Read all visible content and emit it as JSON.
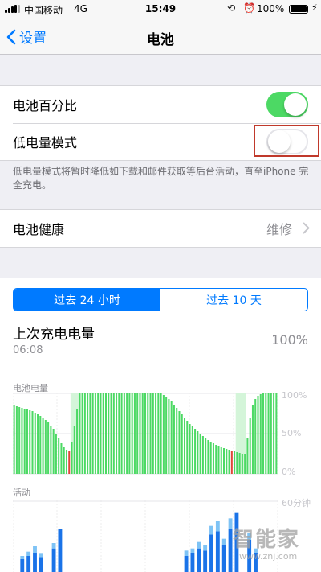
{
  "status_bar": {
    "carrier": "中国移动",
    "network": "4G",
    "time": "15:49",
    "battery_percent": "100%",
    "battery_level": 1.0
  },
  "nav": {
    "back_label": "设置",
    "title": "电池"
  },
  "settings": {
    "battery_percentage": {
      "label": "电池百分比",
      "on": true
    },
    "low_power_mode": {
      "label": "低电量模式",
      "on": false
    },
    "footnote": "低电量模式将暂时降低如下载和邮件获取等后台活动，直至iPhone 完全充电。",
    "battery_health": {
      "label": "电池健康",
      "value": "维修"
    }
  },
  "usage": {
    "tabs": [
      {
        "label": "过去 24 小时",
        "active": true
      },
      {
        "label": "过去 10 天",
        "active": false
      }
    ],
    "last_charge_label": "上次充电电量",
    "last_charge_time": "06:08",
    "last_charge_value": "100%",
    "battery_section_label": "电池电量",
    "battery_ticks": [
      "100%",
      "50%",
      "0%"
    ],
    "activity_section_label": "活动",
    "activity_ticks": [
      "60分钟"
    ]
  },
  "colors": {
    "accent": "#007aff",
    "switch_on": "#4cd964",
    "bar_green": "#4cd964",
    "bar_red": "#e0453a",
    "activity_dark": "#1a73e8",
    "activity_light": "#7ec3f5",
    "highlight_box": "#c0392b"
  },
  "chart_data": [
    {
      "type": "bar",
      "title": "电池电量",
      "ylim": [
        0,
        100
      ],
      "y_ticks": [
        "100%",
        "50%",
        "0%"
      ],
      "values": [
        85,
        84,
        83,
        82,
        81,
        80,
        79,
        78,
        76,
        74,
        72,
        70,
        67,
        64,
        60,
        56,
        50,
        44,
        38,
        33,
        30,
        28,
        40,
        60,
        80,
        100,
        100,
        100,
        100,
        100,
        100,
        100,
        100,
        100,
        100,
        100,
        100,
        100,
        100,
        100,
        100,
        100,
        100,
        100,
        100,
        100,
        100,
        100,
        100,
        100,
        100,
        100,
        100,
        100,
        100,
        100,
        100,
        98,
        96,
        93,
        90,
        86,
        82,
        78,
        74,
        70,
        66,
        62,
        59,
        56,
        53,
        50,
        47,
        44,
        42,
        40,
        38,
        36,
        34,
        33,
        32,
        31,
        30,
        29,
        28,
        27,
        26,
        25,
        25,
        45,
        70,
        85,
        93,
        97,
        99,
        100,
        100,
        100,
        100,
        100,
        100
      ],
      "charging_ranges": [
        [
          22,
          25
        ],
        [
          85,
          88
        ]
      ],
      "low_bars": [
        21,
        83
      ]
    },
    {
      "type": "bar",
      "title": "活动",
      "y_ticks": [
        "60分钟"
      ],
      "series": [
        {
          "values": [
            0,
            12,
            15,
            18,
            14,
            0,
            22,
            40,
            0,
            0,
            0,
            0,
            0,
            0,
            0,
            0,
            0,
            0,
            0,
            0,
            0,
            0,
            0,
            0,
            0,
            0,
            0,
            15,
            18,
            22,
            20,
            35,
            38,
            25,
            40,
            55,
            0,
            30,
            18,
            0,
            0,
            0
          ]
        },
        {
          "values": [
            0,
            3,
            4,
            6,
            3,
            0,
            5,
            0,
            0,
            0,
            0,
            0,
            0,
            0,
            0,
            0,
            0,
            0,
            0,
            0,
            0,
            0,
            0,
            0,
            0,
            0,
            0,
            5,
            4,
            6,
            5,
            8,
            10,
            6,
            10,
            0,
            0,
            6,
            4,
            0,
            0,
            0
          ]
        }
      ]
    }
  ]
}
